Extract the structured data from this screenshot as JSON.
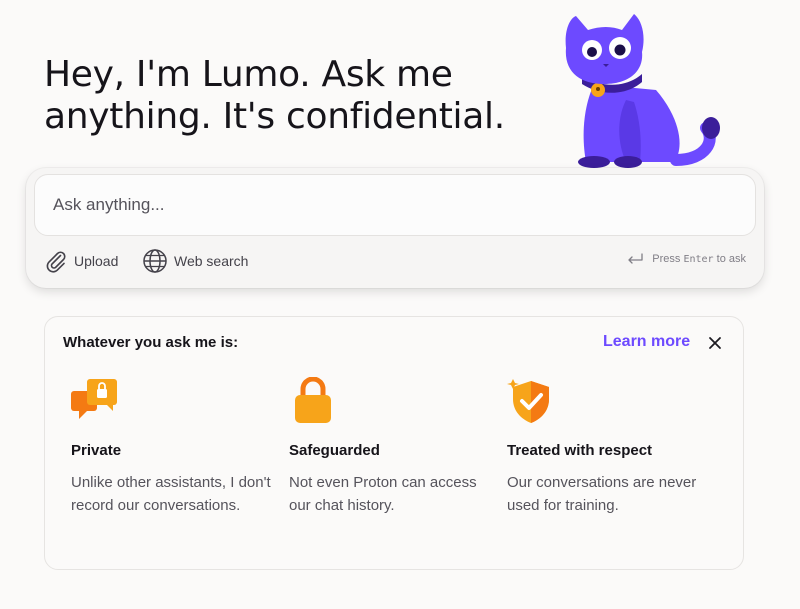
{
  "hero": {
    "title": "Hey, I'm Lumo. Ask me anything. It's confidential."
  },
  "mascot": {
    "icon": "cat-mascot-icon",
    "color": "#6d4aff"
  },
  "composer": {
    "placeholder": "Ask anything...",
    "upload_label": "Upload",
    "web_search_label": "Web search",
    "enter_hint_prefix": "Press",
    "enter_hint_key": "Enter",
    "enter_hint_suffix": "to ask"
  },
  "info_card": {
    "heading": "Whatever you ask me is:",
    "learn_more": "Learn more",
    "features": [
      {
        "icon": "chat-lock-icon",
        "title": "Private",
        "description": "Unlike other assistants, I don't record our conversations."
      },
      {
        "icon": "padlock-icon",
        "title": "Safeguarded",
        "description": "Not even Proton can access our chat history."
      },
      {
        "icon": "shield-check-icon",
        "title": "Treated with respect",
        "description": "Our conversations are never used for training."
      }
    ]
  },
  "colors": {
    "accent": "#6d4aff",
    "feature_orange": "#f7a41a"
  }
}
